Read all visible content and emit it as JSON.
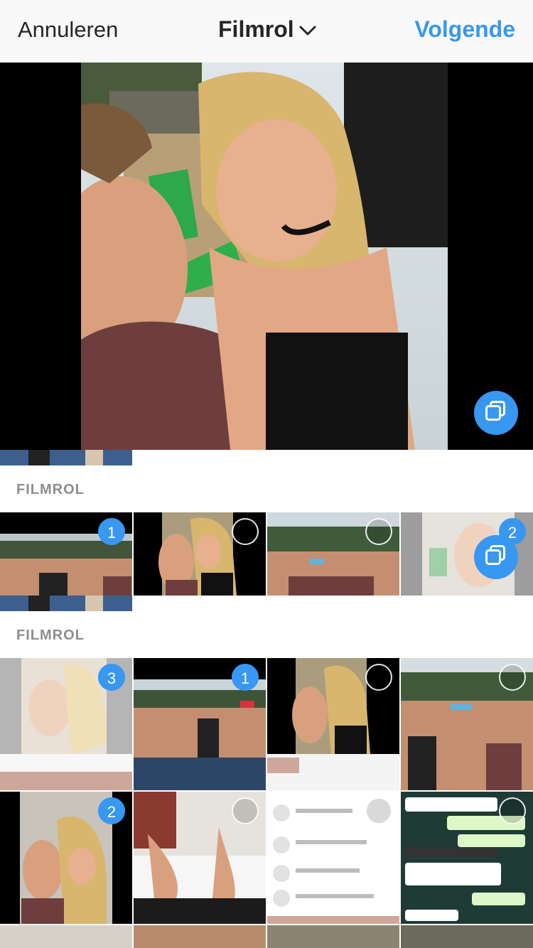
{
  "nav": {
    "cancel_label": "Annuleren",
    "title": "Filmrol",
    "next_label": "Volgende"
  },
  "sections": [
    {
      "label": "FILMROL"
    },
    {
      "label": "FILMROL"
    }
  ],
  "badges": {
    "row1": [
      "1",
      "",
      "",
      "2"
    ],
    "row2": [
      "3",
      "1",
      "",
      ""
    ],
    "row3": [
      "2",
      "",
      "",
      ""
    ]
  },
  "colors": {
    "accent": "#3897f0",
    "nav_bg": "#f9f9f9",
    "label": "#8e8e8e"
  },
  "icons": {
    "title_chevron": "chevron-down-icon",
    "multi_select": "multi-select-icon",
    "selection_circle": "selection-circle-icon"
  }
}
